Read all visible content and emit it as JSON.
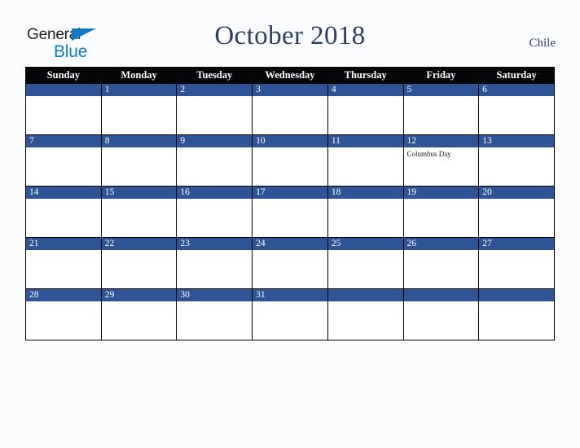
{
  "logo": {
    "line1": "General",
    "line2": "Blue",
    "triangle_color": "#1279c6",
    "text_color": "#231f20"
  },
  "header": {
    "title": "October 2018",
    "country": "Chile",
    "title_color": "#2b3f63"
  },
  "calendar": {
    "weekday_headers": [
      "Sunday",
      "Monday",
      "Tuesday",
      "Wednesday",
      "Thursday",
      "Friday",
      "Saturday"
    ],
    "header_bg": "#050608",
    "header_text": "#ffffff",
    "daybar_bg": "#2f5496",
    "daybar_text": "#ffffff",
    "cell_bg": "#ffffff",
    "weeks": [
      [
        {
          "date": "",
          "events": []
        },
        {
          "date": "1",
          "events": []
        },
        {
          "date": "2",
          "events": []
        },
        {
          "date": "3",
          "events": []
        },
        {
          "date": "4",
          "events": []
        },
        {
          "date": "5",
          "events": []
        },
        {
          "date": "6",
          "events": []
        }
      ],
      [
        {
          "date": "7",
          "events": []
        },
        {
          "date": "8",
          "events": []
        },
        {
          "date": "9",
          "events": []
        },
        {
          "date": "10",
          "events": []
        },
        {
          "date": "11",
          "events": []
        },
        {
          "date": "12",
          "events": [
            "Columbus Day"
          ]
        },
        {
          "date": "13",
          "events": []
        }
      ],
      [
        {
          "date": "14",
          "events": []
        },
        {
          "date": "15",
          "events": []
        },
        {
          "date": "16",
          "events": []
        },
        {
          "date": "17",
          "events": []
        },
        {
          "date": "18",
          "events": []
        },
        {
          "date": "19",
          "events": []
        },
        {
          "date": "20",
          "events": []
        }
      ],
      [
        {
          "date": "21",
          "events": []
        },
        {
          "date": "22",
          "events": []
        },
        {
          "date": "23",
          "events": []
        },
        {
          "date": "24",
          "events": []
        },
        {
          "date": "25",
          "events": []
        },
        {
          "date": "26",
          "events": []
        },
        {
          "date": "27",
          "events": []
        }
      ],
      [
        {
          "date": "28",
          "events": []
        },
        {
          "date": "29",
          "events": []
        },
        {
          "date": "30",
          "events": []
        },
        {
          "date": "31",
          "events": []
        },
        {
          "date": "",
          "events": []
        },
        {
          "date": "",
          "events": []
        },
        {
          "date": "",
          "events": []
        }
      ]
    ]
  }
}
